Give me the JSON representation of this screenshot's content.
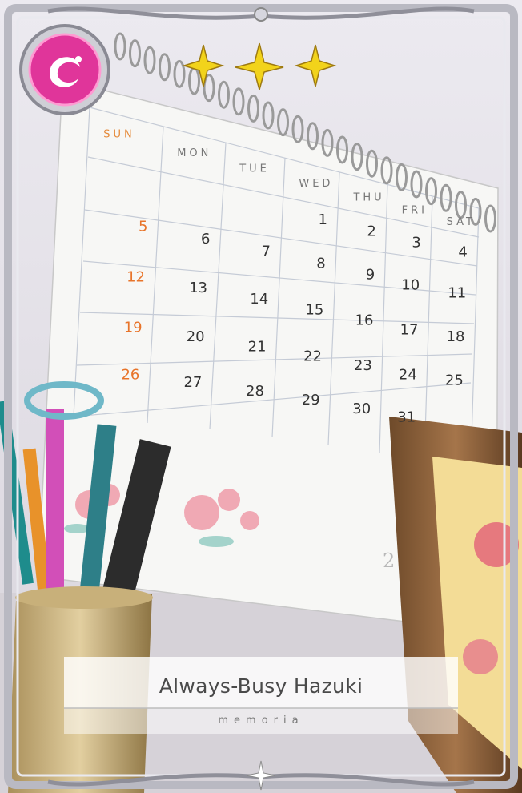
{
  "card": {
    "title": "Always-Busy Hazuki",
    "subtitle": "memoria",
    "rarity_stars": 3,
    "attribute_icon": "pink-swirl-attribute-icon",
    "colors": {
      "attribute": "#e0359a",
      "star": "#f2d31b",
      "frame": "#c9c9cf"
    }
  },
  "calendar": {
    "page_number": "2",
    "weekdays": [
      "SUN",
      "MON",
      "TUE",
      "WED",
      "THU",
      "FRI",
      "SAT"
    ],
    "rows": [
      [
        "",
        "",
        "",
        "1",
        "2",
        "3",
        "4"
      ],
      [
        "5",
        "6",
        "7",
        "8",
        "9",
        "10",
        "11"
      ],
      [
        "12",
        "13",
        "14",
        "15",
        "16",
        "17",
        "18"
      ],
      [
        "19",
        "20",
        "21",
        "22",
        "23",
        "24",
        "25"
      ],
      [
        "26",
        "27",
        "28",
        "29",
        "30",
        "31",
        ""
      ]
    ]
  }
}
